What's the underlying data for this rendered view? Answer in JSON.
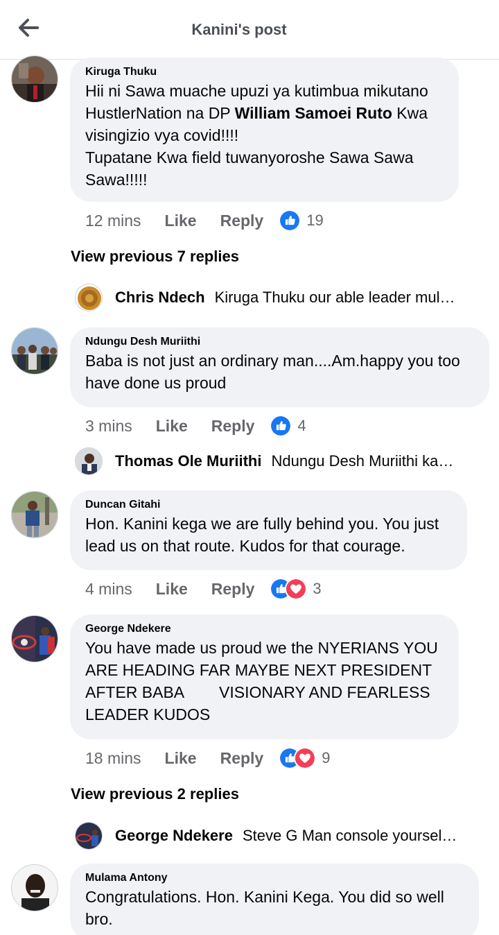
{
  "header": {
    "title": "Kanini's post"
  },
  "comments": [
    {
      "author": "Kiruga Thuku",
      "text_pre": "Hii ni Sawa muache upuzi ya kutimbua mikutano HustlerNation na DP ",
      "text_bold": "William Samoei Ruto",
      "text_post": " Kwa visingizio vya covid!!!!\n Tupatane Kwa field tuwanyoroshe Sawa Sawa Sawa!!!!!",
      "time": "12 mins",
      "like": "Like",
      "reply": "Reply",
      "reaction_count": "19",
      "reactions": [
        "like-icon"
      ]
    },
    {
      "author": "Ndungu Desh Muriithi",
      "text": "Baba is not just an ordinary man....Am.happy you too have done us proud",
      "time": "3 mins",
      "like": "Like",
      "reply": "Reply",
      "reaction_count": "4",
      "reactions": [
        "like-icon"
      ]
    },
    {
      "author": "Duncan Gitahi",
      "text": "Hon. Kanini kega we are fully behind you. You just lead us on that route. Kudos for that courage.",
      "time": "4 mins",
      "like": "Like",
      "reply": "Reply",
      "reaction_count": "3",
      "reactions": [
        "like-icon",
        "love-icon"
      ]
    },
    {
      "author": "George Ndekere",
      "text": "You have made us proud we the NYERIANS YOU ARE HEADING FAR MAYBE NEXT PRESIDENT AFTER BABA        VISIONARY AND FEARLESS LEADER KUDOS",
      "time": "18 mins",
      "like": "Like",
      "reply": "Reply",
      "reaction_count": "9",
      "reactions": [
        "like-icon",
        "love-icon"
      ]
    },
    {
      "author": "Mulama Antony",
      "text": "Congratulations.  Hon. Kanini Kega. You did so well bro."
    }
  ],
  "view_previous": [
    {
      "label": "View previous 7 replies"
    },
    {
      "label": "View previous 2 replies"
    }
  ],
  "collapsed_replies": [
    {
      "name": "Chris Ndech",
      "text": "Kiruga Thuku our able leader mul…"
    },
    {
      "name": "Thomas Ole Muriithi",
      "text": "Ndungu Desh Muriithi ka…"
    },
    {
      "name": "George Ndekere",
      "text": "Steve G Man console yoursel…"
    }
  ],
  "colors": {
    "like": "#1877f2",
    "love": "#f33e58",
    "bubble": "#f0f2f5",
    "meta": "#65676b"
  }
}
